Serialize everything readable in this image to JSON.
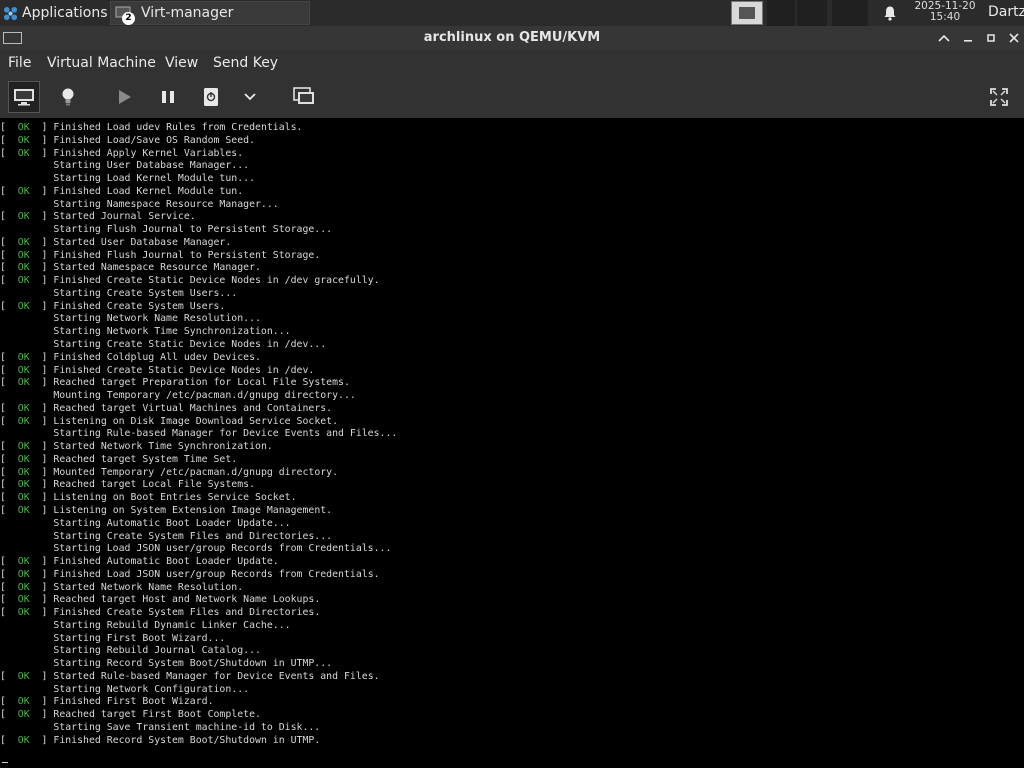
{
  "panel": {
    "applications_label": "Applications",
    "task_label": "Virt-manager",
    "task_badge": "2",
    "clock_date": "2025-11-20",
    "clock_time": "15:40",
    "user": "Dartz"
  },
  "window": {
    "title": "archlinux on QEMU/KVM"
  },
  "menubar": [
    "File",
    "Virtual Machine",
    "View",
    "Send Key"
  ],
  "toolbar": {
    "icons": [
      "monitor-icon",
      "lightbulb-icon",
      "play-icon",
      "pause-icon",
      "power-icon",
      "chevron-down-icon",
      "snapshot-screen-icon",
      "fullscreen-icon"
    ]
  },
  "colors": {
    "ok_green": "#3fbf3f",
    "console_bg": "#000000",
    "panel_bg": "#2b2b2b",
    "chrome_bg": "#323232"
  },
  "console": {
    "lines": [
      {
        "s": "OK",
        "t": "Finished Load udev Rules from Credentials."
      },
      {
        "s": "OK",
        "t": "Finished Load/Save OS Random Seed."
      },
      {
        "s": "OK",
        "t": "Finished Apply Kernel Variables."
      },
      {
        "s": "",
        "t": "Starting User Database Manager..."
      },
      {
        "s": "",
        "t": "Starting Load Kernel Module tun..."
      },
      {
        "s": "OK",
        "t": "Finished Load Kernel Module tun."
      },
      {
        "s": "",
        "t": "Starting Namespace Resource Manager..."
      },
      {
        "s": "OK",
        "t": "Started Journal Service."
      },
      {
        "s": "",
        "t": "Starting Flush Journal to Persistent Storage..."
      },
      {
        "s": "OK",
        "t": "Started User Database Manager."
      },
      {
        "s": "OK",
        "t": "Finished Flush Journal to Persistent Storage."
      },
      {
        "s": "OK",
        "t": "Started Namespace Resource Manager."
      },
      {
        "s": "OK",
        "t": "Finished Create Static Device Nodes in /dev gracefully."
      },
      {
        "s": "",
        "t": "Starting Create System Users..."
      },
      {
        "s": "OK",
        "t": "Finished Create System Users."
      },
      {
        "s": "",
        "t": "Starting Network Name Resolution..."
      },
      {
        "s": "",
        "t": "Starting Network Time Synchronization..."
      },
      {
        "s": "",
        "t": "Starting Create Static Device Nodes in /dev..."
      },
      {
        "s": "OK",
        "t": "Finished Coldplug All udev Devices."
      },
      {
        "s": "OK",
        "t": "Finished Create Static Device Nodes in /dev."
      },
      {
        "s": "OK",
        "t": "Reached target Preparation for Local File Systems."
      },
      {
        "s": "",
        "t": "Mounting Temporary /etc/pacman.d/gnupg directory..."
      },
      {
        "s": "OK",
        "t": "Reached target Virtual Machines and Containers."
      },
      {
        "s": "OK",
        "t": "Listening on Disk Image Download Service Socket."
      },
      {
        "s": "",
        "t": "Starting Rule-based Manager for Device Events and Files..."
      },
      {
        "s": "OK",
        "t": "Started Network Time Synchronization."
      },
      {
        "s": "OK",
        "t": "Reached target System Time Set."
      },
      {
        "s": "OK",
        "t": "Mounted Temporary /etc/pacman.d/gnupg directory."
      },
      {
        "s": "OK",
        "t": "Reached target Local File Systems."
      },
      {
        "s": "OK",
        "t": "Listening on Boot Entries Service Socket."
      },
      {
        "s": "OK",
        "t": "Listening on System Extension Image Management."
      },
      {
        "s": "",
        "t": "Starting Automatic Boot Loader Update..."
      },
      {
        "s": "",
        "t": "Starting Create System Files and Directories..."
      },
      {
        "s": "",
        "t": "Starting Load JSON user/group Records from Credentials..."
      },
      {
        "s": "OK",
        "t": "Finished Automatic Boot Loader Update."
      },
      {
        "s": "OK",
        "t": "Finished Load JSON user/group Records from Credentials."
      },
      {
        "s": "OK",
        "t": "Started Network Name Resolution."
      },
      {
        "s": "OK",
        "t": "Reached target Host and Network Name Lookups."
      },
      {
        "s": "OK",
        "t": "Finished Create System Files and Directories."
      },
      {
        "s": "",
        "t": "Starting Rebuild Dynamic Linker Cache..."
      },
      {
        "s": "",
        "t": "Starting First Boot Wizard..."
      },
      {
        "s": "",
        "t": "Starting Rebuild Journal Catalog..."
      },
      {
        "s": "",
        "t": "Starting Record System Boot/Shutdown in UTMP..."
      },
      {
        "s": "OK",
        "t": "Started Rule-based Manager for Device Events and Files."
      },
      {
        "s": "",
        "t": "Starting Network Configuration..."
      },
      {
        "s": "OK",
        "t": "Finished First Boot Wizard."
      },
      {
        "s": "OK",
        "t": "Reached target First Boot Complete."
      },
      {
        "s": "",
        "t": "Starting Save Transient machine-id to Disk..."
      },
      {
        "s": "OK",
        "t": "Finished Record System Boot/Shutdown in UTMP."
      }
    ]
  }
}
